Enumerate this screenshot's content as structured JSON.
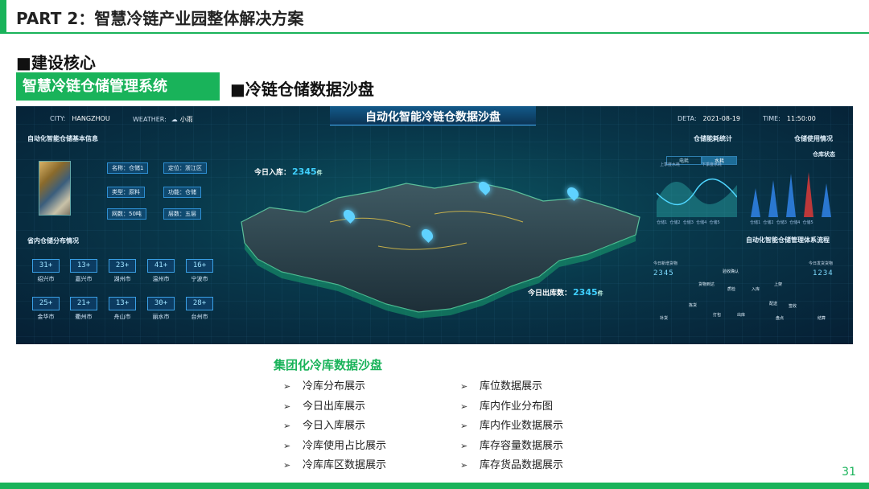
{
  "header": {
    "title": "PART 2：智慧冷链产业园整体解决方案"
  },
  "section": {
    "heading": "■建设核心",
    "system_tag": "智慧冷链仓储管理系统",
    "sandbox_heading": "■冷链仓储数据沙盘"
  },
  "dashboard": {
    "title": "自动化智能冷链仓数据沙盘",
    "city": {
      "label": "CITY:",
      "value": "HANGZHOU"
    },
    "weather": {
      "label": "WEATHER:",
      "value": "小雨"
    },
    "date": {
      "label": "DETA:",
      "value": "2021-08-19"
    },
    "time": {
      "label": "TIME:",
      "value": "11:50:00"
    },
    "basic_info": {
      "title": "自动化智能仓储基本信息",
      "items": [
        "名称：仓储1",
        "定位：浙江区",
        "类型：原料",
        "功能：仓储",
        "网数：50吨",
        "层数：五层"
      ]
    },
    "province": {
      "title": "省内仓储分布情况",
      "cities": [
        {
          "count": "31+",
          "name": "绍兴市"
        },
        {
          "count": "13+",
          "name": "嘉兴市"
        },
        {
          "count": "23+",
          "name": "湖州市"
        },
        {
          "count": "41+",
          "name": "温州市"
        },
        {
          "count": "16+",
          "name": "宁波市"
        },
        {
          "count": "25+",
          "name": "金华市"
        },
        {
          "count": "21+",
          "name": "衢州市"
        },
        {
          "count": "13+",
          "name": "舟山市"
        },
        {
          "count": "30+",
          "name": "丽水市"
        },
        {
          "count": "28+",
          "name": "台州市"
        }
      ]
    },
    "today_in": {
      "label": "今日入库：",
      "value": "2345",
      "unit": "件"
    },
    "today_out": {
      "label": "今日出库数：",
      "value": "2345",
      "unit": "件"
    },
    "energy": {
      "title": "仓储能耗统计",
      "tabs": [
        "电耗",
        "水耗"
      ],
      "active_tab": 1,
      "legend": [
        "上季度水耗",
        "下季度水耗"
      ],
      "axis": [
        "仓储1",
        "仓储2",
        "仓储3",
        "仓储4",
        "仓储5"
      ]
    },
    "usage": {
      "title": "仓储使用情况",
      "subtitle": "仓库状态",
      "axis": [
        "仓储1",
        "仓储2",
        "仓储3",
        "仓储4",
        "仓储5"
      ]
    },
    "flow": {
      "title": "自动化智能仓储管理体系流程",
      "left_label": "今日新增货物",
      "left_value": "2345",
      "right_label": "今日发货货物",
      "right_value": "1234",
      "nodes": [
        "货物到达",
        "验收确认",
        "质检",
        "入库",
        "上架",
        "拣货",
        "打包",
        "出库",
        "配送",
        "签收",
        "补货",
        "盘点",
        "结算"
      ]
    },
    "colors": {
      "accent": "#3fd0ff",
      "bar_blue": "#2f7fe0",
      "bar_red": "#d03a3a"
    }
  },
  "bullets": {
    "heading": "集团化冷库数据沙盘",
    "left": [
      "冷库分布展示",
      "今日出库展示",
      "今日入库展示",
      "冷库使用占比展示",
      "冷库库区数据展示"
    ],
    "right": [
      "库位数据展示",
      "库内作业分布图",
      "库内作业数据展示",
      "库存容量数据展示",
      "库存货品数据展示"
    ],
    "arrow": "➢"
  },
  "footer": {
    "page_number": "31"
  },
  "colors": {
    "brand_green": "#19b35a"
  }
}
